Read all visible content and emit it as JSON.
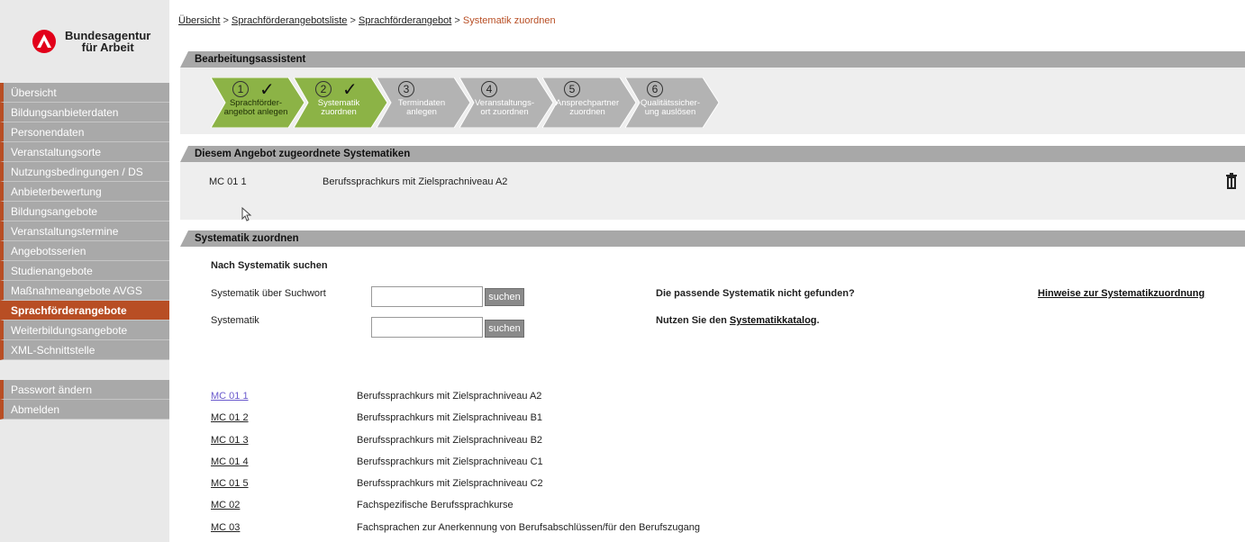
{
  "brand": {
    "line1": "Bundesagentur",
    "line2": "für Arbeit",
    "color": "#e2001a"
  },
  "sidebar": {
    "items": [
      {
        "label": "Übersicht"
      },
      {
        "label": "Bildungsanbieterdaten"
      },
      {
        "label": "Personendaten"
      },
      {
        "label": "Veranstaltungsorte"
      },
      {
        "label": "Nutzungsbedingungen / DS"
      },
      {
        "label": "Anbieterbewertung"
      },
      {
        "label": "Bildungsangebote"
      },
      {
        "label": "Veranstaltungstermine"
      },
      {
        "label": "Angebotsserien"
      },
      {
        "label": "Studienangebote"
      },
      {
        "label": "Maßnahmeangebote AVGS"
      },
      {
        "label": "Sprachförderangebote"
      },
      {
        "label": "Weiterbildungsangebote"
      },
      {
        "label": "XML-Schnittstelle"
      }
    ],
    "active_label": "Sprachförderangebote",
    "secondary": [
      {
        "label": "Passwort ändern"
      },
      {
        "label": "Abmelden"
      }
    ],
    "accent": "#b84e24"
  },
  "breadcrumb": {
    "items": [
      "Übersicht",
      "Sprachförderangebotsliste",
      "Sprachförderangebot"
    ],
    "separator": ">",
    "current": "Systematik zuordnen"
  },
  "wizard": {
    "title": "Bearbeitungsassistent",
    "steps": [
      {
        "number": "1",
        "line1": "Sprachförder-",
        "line2": "angebot anlegen",
        "done": true
      },
      {
        "number": "2",
        "line1": "Systematik",
        "line2": "zuordnen",
        "done": true
      },
      {
        "number": "3",
        "line1": "Termindaten",
        "line2": "anlegen",
        "done": false
      },
      {
        "number": "4",
        "line1": "Veranstaltungs-",
        "line2": "ort zuordnen",
        "done": false
      },
      {
        "number": "5",
        "line1": "Ansprechpartner",
        "line2": "zuordnen",
        "done": false
      },
      {
        "number": "6",
        "line1": "Qualitätssicher-",
        "line2": "ung auslösen",
        "done": false
      }
    ],
    "check_glyph": "✓",
    "done_color": "#8cb346",
    "todo_color": "#b3b3b3"
  },
  "assigned": {
    "title": "Diesem Angebot zugeordnete Systematiken",
    "code": "MC 01 1",
    "description": "Berufssprachkurs mit Zielsprachniveau A2",
    "delete_icon": "trash-icon"
  },
  "assign": {
    "title": "Systematik zuordnen",
    "search_heading": "Nach Systematik suchen",
    "keyword_label": "Systematik über Suchwort",
    "keyword_value": "",
    "systematik_label": "Systematik",
    "systematik_value": "",
    "search_button": "suchen",
    "not_found_text": "Die passende Systematik nicht gefunden?",
    "use_prefix": "Nutzen Sie den ",
    "catalog_link": "Systematikkatalog",
    "use_suffix": ".",
    "help_link": "Hinweise zur Systematikzuordnung"
  },
  "results": [
    {
      "code": "MC 01 1",
      "description": "Berufssprachkurs mit Zielsprachniveau A2",
      "visited": true
    },
    {
      "code": "MC 01 2",
      "description": "Berufssprachkurs mit Zielsprachniveau B1",
      "visited": false
    },
    {
      "code": "MC 01 3",
      "description": "Berufssprachkurs mit Zielsprachniveau B2",
      "visited": false
    },
    {
      "code": "MC 01 4",
      "description": "Berufssprachkurs mit Zielsprachniveau C1",
      "visited": false
    },
    {
      "code": "MC 01 5",
      "description": "Berufssprachkurs mit Zielsprachniveau C2",
      "visited": false
    },
    {
      "code": "MC 02",
      "description": "Fachspezifische Berufssprachkurse",
      "visited": false
    },
    {
      "code": "MC 03",
      "description": "Fachsprachen zur Anerkennung von Berufsabschlüssen/für den Berufszugang",
      "visited": false
    }
  ]
}
